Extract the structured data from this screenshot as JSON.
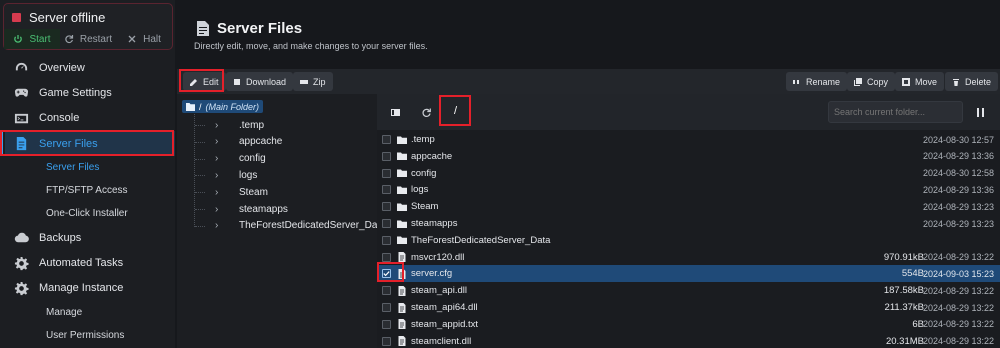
{
  "server": {
    "status": "Server offline",
    "start_label": "Start",
    "restart_label": "Restart",
    "halt_label": "Halt"
  },
  "nav": {
    "items": [
      {
        "label": "Overview",
        "icon": "gauge-icon"
      },
      {
        "label": "Game Settings",
        "icon": "gamepad-icon"
      },
      {
        "label": "Console",
        "icon": "terminal-icon"
      },
      {
        "label": "Server Files",
        "icon": "file-icon"
      }
    ],
    "sub_server_files": [
      "Server Files",
      "FTP/SFTP Access",
      "One-Click Installer"
    ],
    "items2": [
      {
        "label": "Backups",
        "icon": "cloud-icon"
      },
      {
        "label": "Automated Tasks",
        "icon": "gear-icon"
      },
      {
        "label": "Manage Instance",
        "icon": "gear-icon"
      }
    ],
    "sub_manage": [
      "Manage",
      "User Permissions"
    ]
  },
  "header": {
    "title": "Server Files",
    "subtitle": "Directly edit, move, and make changes to your server files."
  },
  "toolbar": {
    "edit": "Edit",
    "download": "Download",
    "zip": "Zip",
    "rename": "Rename",
    "copy": "Copy",
    "move": "Move",
    "delete": "Delete"
  },
  "tree": {
    "root_path": "/",
    "root_label": "(Main Folder)",
    "folders": [
      ".temp",
      "appcache",
      "config",
      "logs",
      "Steam",
      "steamapps",
      "TheForestDedicatedServer_Data"
    ]
  },
  "list": {
    "path": "/",
    "search_placeholder": "Search current folder...",
    "rows": [
      {
        "name": ".temp",
        "type": "folder",
        "size": "",
        "date": "2024-08-30 12:57"
      },
      {
        "name": "appcache",
        "type": "folder",
        "size": "",
        "date": "2024-08-29 13:36"
      },
      {
        "name": "config",
        "type": "folder",
        "size": "",
        "date": "2024-08-30 12:58"
      },
      {
        "name": "logs",
        "type": "folder",
        "size": "",
        "date": "2024-08-29 13:36"
      },
      {
        "name": "Steam",
        "type": "folder",
        "size": "",
        "date": "2024-08-29 13:23"
      },
      {
        "name": "steamapps",
        "type": "folder",
        "size": "",
        "date": "2024-08-29 13:23"
      },
      {
        "name": "TheForestDedicatedServer_Data",
        "type": "folder",
        "size": "",
        "date": ""
      },
      {
        "name": "msvcr120.dll",
        "type": "file",
        "size": "970.91kB",
        "date": "2024-08-29 13:22"
      },
      {
        "name": "server.cfg",
        "type": "file",
        "size": "554B",
        "date": "2024-09-03 15:23",
        "selected": true
      },
      {
        "name": "steam_api.dll",
        "type": "file",
        "size": "187.58kB",
        "date": "2024-08-29 13:22"
      },
      {
        "name": "steam_api64.dll",
        "type": "file",
        "size": "211.37kB",
        "date": "2024-08-29 13:22"
      },
      {
        "name": "steam_appid.txt",
        "type": "file",
        "size": "6B",
        "date": "2024-08-29 13:22"
      },
      {
        "name": "steamclient.dll",
        "type": "file",
        "size": "20.31MB",
        "date": "2024-08-29 13:22"
      }
    ]
  },
  "colors": {
    "accent": "#3aa0ee",
    "highlight": "#e4202a",
    "offline": "#d63b4f",
    "selected_row": "#1f4a78"
  }
}
